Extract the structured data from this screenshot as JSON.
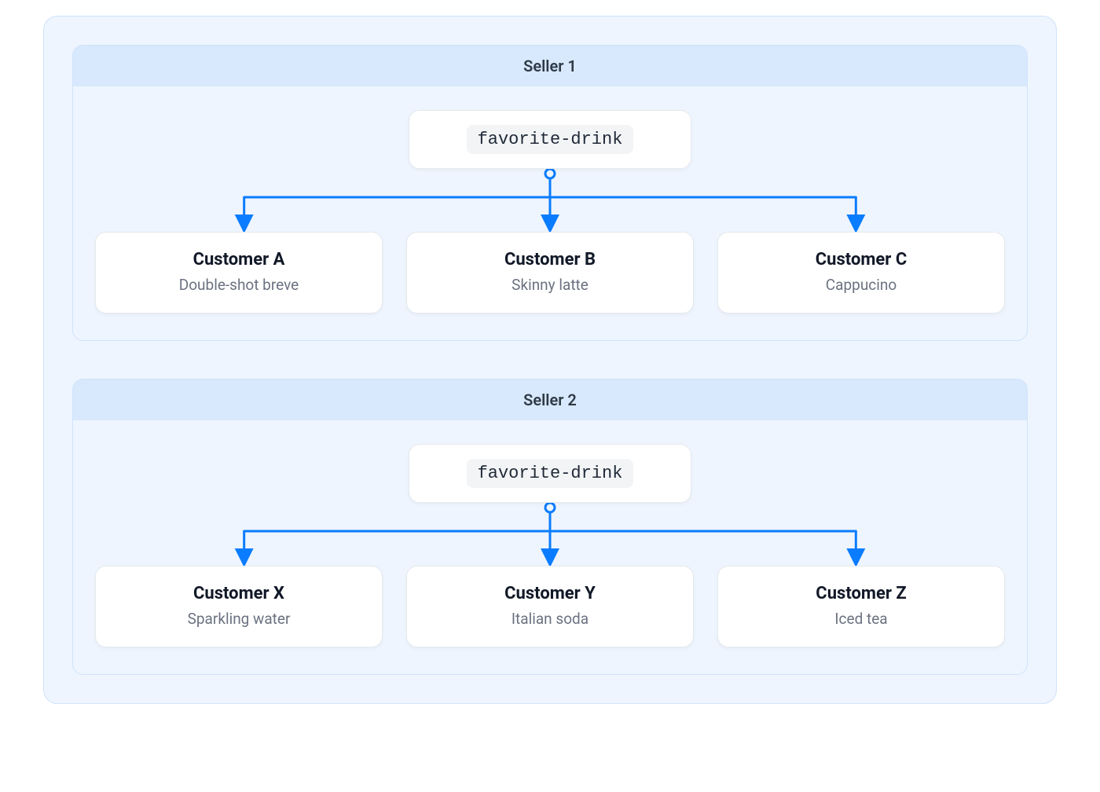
{
  "sellers": [
    {
      "title": "Seller 1",
      "attribute": "favorite-drink",
      "customers": [
        {
          "name": "Customer A",
          "drink": "Double-shot breve"
        },
        {
          "name": "Customer B",
          "drink": "Skinny latte"
        },
        {
          "name": "Customer C",
          "drink": "Cappucino"
        }
      ]
    },
    {
      "title": "Seller 2",
      "attribute": "favorite-drink",
      "customers": [
        {
          "name": "Customer X",
          "drink": "Sparkling water"
        },
        {
          "name": "Customer Y",
          "drink": "Italian soda"
        },
        {
          "name": "Customer Z",
          "drink": "Iced tea"
        }
      ]
    }
  ],
  "colors": {
    "accent": "#0a7cff",
    "panel_bg": "#eef5fe",
    "panel_border": "#cfe2fb",
    "header_bg": "#d8e9fd",
    "text_primary": "#111827",
    "text_secondary": "#6b7280"
  }
}
